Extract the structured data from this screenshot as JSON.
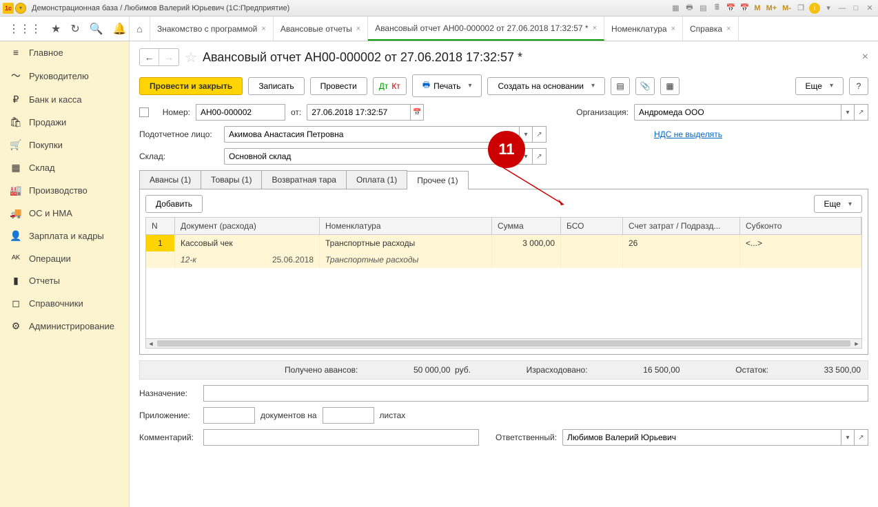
{
  "titlebar": {
    "title": "Демонстрационная база / Любимов Валерий Юрьевич   (1С:Предприятие)",
    "m1": "M",
    "m2": "M+",
    "m3": "M-"
  },
  "topTabs": [
    {
      "label": "Знакомство с программой"
    },
    {
      "label": "Авансовые отчеты"
    },
    {
      "label": "Авансовый отчет АН00-000002 от 27.06.2018 17:32:57 *",
      "active": true
    },
    {
      "label": "Номенклатура"
    },
    {
      "label": "Справка"
    }
  ],
  "sidebar": [
    {
      "icon": "≡",
      "label": "Главное"
    },
    {
      "icon": "〜",
      "label": "Руководителю"
    },
    {
      "icon": "₽",
      "label": "Банк и касса"
    },
    {
      "icon": "🛍",
      "label": "Продажи"
    },
    {
      "icon": "🛒",
      "label": "Покупки"
    },
    {
      "icon": "▦",
      "label": "Склад"
    },
    {
      "icon": "🏭",
      "label": "Производство"
    },
    {
      "icon": "🚚",
      "label": "ОС и НМА"
    },
    {
      "icon": "👤",
      "label": "Зарплата и кадры"
    },
    {
      "icon": "ᴬᴷ",
      "label": "Операции"
    },
    {
      "icon": "▮",
      "label": "Отчеты"
    },
    {
      "icon": "◻",
      "label": "Справочники"
    },
    {
      "icon": "⚙",
      "label": "Администрирование"
    }
  ],
  "docTitle": "Авансовый отчет АН00-000002 от 27.06.2018 17:32:57 *",
  "actions": {
    "primary": "Провести и закрыть",
    "save": "Записать",
    "post": "Провести",
    "print": "Печать",
    "createOn": "Создать на основании",
    "more": "Еще"
  },
  "form": {
    "numLabel": "Номер:",
    "numValue": "АН00-000002",
    "fromLabel": "от:",
    "dateValue": "27.06.2018 17:32:57",
    "orgLabel": "Организация:",
    "orgValue": "Андромеда ООО",
    "personLabel": "Подотчетное лицо:",
    "personValue": "Акимова Анастасия Петровна",
    "ndsLink": "НДС не выделять",
    "storeLabel": "Склад:",
    "storeValue": "Основной склад"
  },
  "ptabs": [
    "Авансы (1)",
    "Товары (1)",
    "Возвратная тара",
    "Оплата (1)",
    "Прочее (1)"
  ],
  "ptabActive": 4,
  "addBtn": "Добавить",
  "moreBtn": "Еще",
  "gridHead": [
    "N",
    "Документ (расхода)",
    "Номенклатура",
    "Сумма",
    "БСО",
    "Счет затрат / Подразд...",
    "Субконто"
  ],
  "row1": {
    "n": "1",
    "doc": "Кассовый чек",
    "nom": "Транспортные расходы",
    "sum": "3 000,00",
    "bso": "",
    "acc": "26",
    "sub": "<...>"
  },
  "row2": {
    "docnum": "12-к",
    "date": "25.06.2018",
    "nom": "Транспортные расходы"
  },
  "totals": {
    "advLabel": "Получено авансов:",
    "advVal": "50 000,00",
    "cur": "руб.",
    "spentLabel": "Израсходовано:",
    "spentVal": "16 500,00",
    "restLabel": "Остаток:",
    "restVal": "33 500,00"
  },
  "bottom": {
    "purposeLabel": "Назначение:",
    "attachLabel": "Приложение:",
    "docsOn": "документов на",
    "sheets": "листах",
    "commentLabel": "Комментарий:",
    "respLabel": "Ответственный:",
    "respVal": "Любимов Валерий Юрьевич"
  },
  "annotation": "11"
}
